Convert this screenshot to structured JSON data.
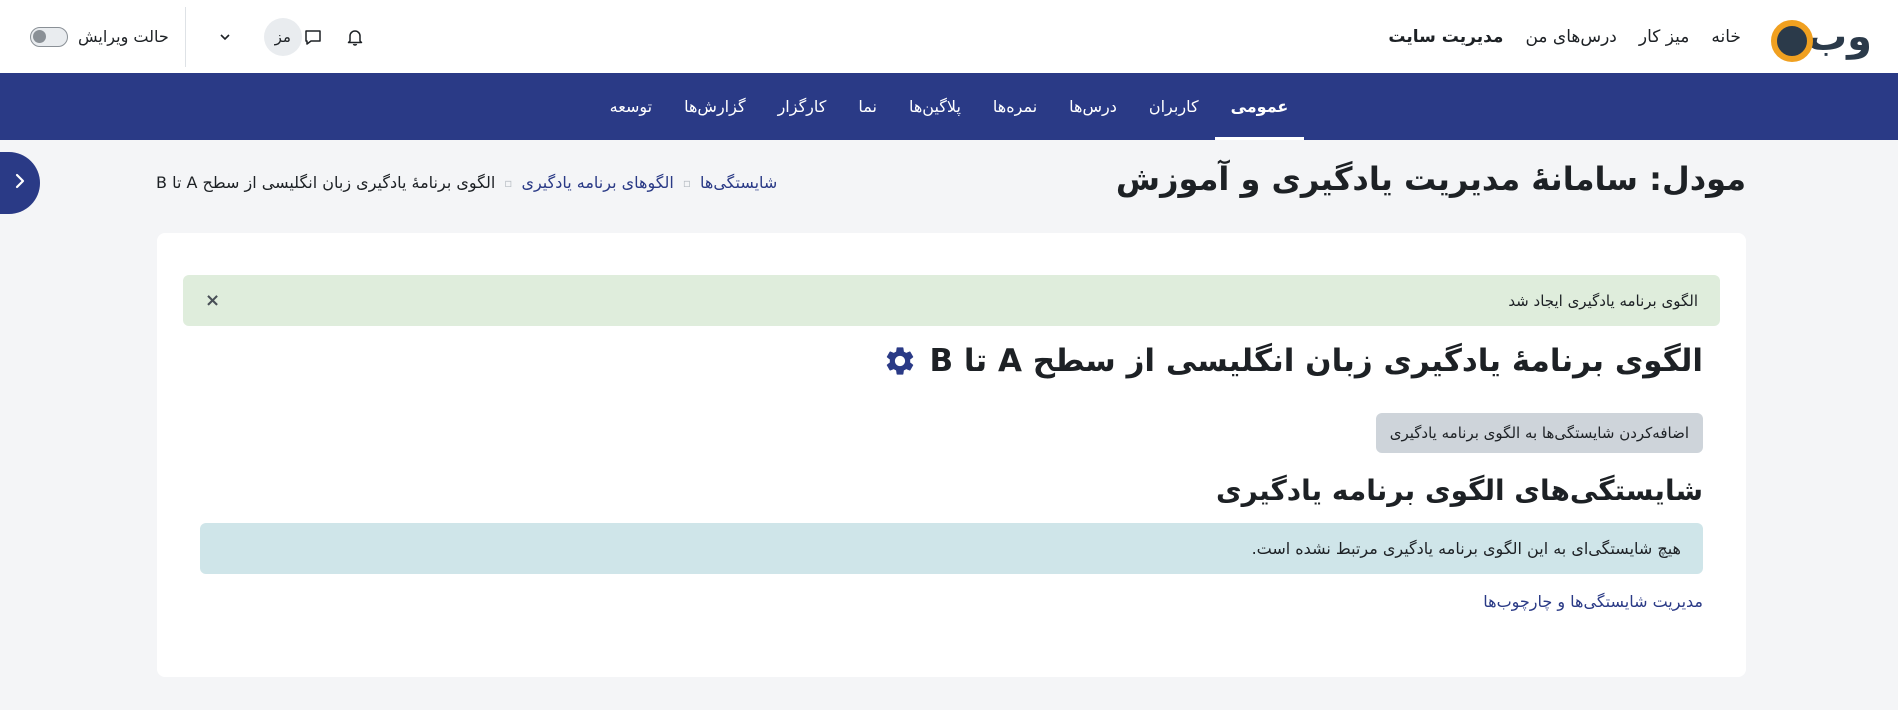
{
  "header": {
    "logo_text": "وب",
    "nav": [
      "خانه",
      "میز کار",
      "درس‌های من",
      "مدیریت سایت"
    ],
    "edit_mode_label": "حالت ویرایش",
    "avatar_initials": "مز"
  },
  "secondary_nav": [
    "عمومی",
    "کاربران",
    "درس‌ها",
    "نمره‌ها",
    "پلاگین‌ها",
    "نما",
    "کارگزار",
    "گزارش‌ها",
    "توسعه"
  ],
  "page": {
    "title": "مودل: سامانهٔ مدیریت یادگیری و آموزش"
  },
  "breadcrumb": {
    "items": [
      "شایستگی‌ها",
      "الگوهای برنامه یادگیری"
    ],
    "current": "الگوی برنامهٔ یادگیری زبان انگلیسی از سطح A تا B"
  },
  "main": {
    "success_alert": "الگوی برنامه یادگیری ایجاد شد",
    "close_symbol": "×",
    "plan_title": "الگوی برنامهٔ یادگیری زبان انگلیسی از سطح A تا B",
    "add_button": "اضافه‌کردن شایستگی‌ها به الگوی برنامه یادگیری",
    "section_title": "شایستگی‌های الگوی برنامه یادگیری",
    "info_alert": "هیچ شایستگی‌ای به این الگوی برنامه یادگیری مرتبط نشده است.",
    "manage_link": "مدیریت شایستگی‌ها و چارچوب‌ها"
  },
  "colors": {
    "brand_navy": "#2a3a86",
    "logo_orange": "#f0a020",
    "success_bg": "#dfeddc",
    "info_bg": "#cfe5e9"
  },
  "icons": {
    "notifications": "bell-icon",
    "messages": "chat-icon",
    "user_menu": "chevron-down-icon",
    "drawer": "chevron-right-icon",
    "plan_settings": "gear-icon",
    "dismiss": "close-icon"
  }
}
